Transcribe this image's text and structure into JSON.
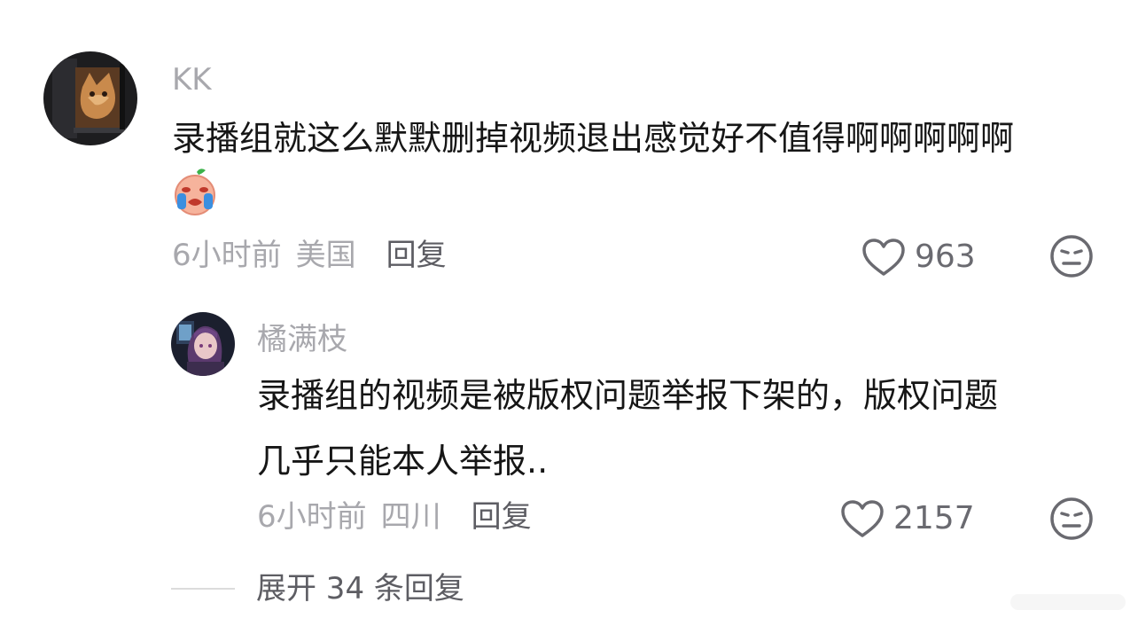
{
  "comments": [
    {
      "username": "KK",
      "text_line1": "录播组就这么默默删掉视频退出感觉好不值得啊啊啊啊啊",
      "emoji": "crying-face-emoji",
      "time": "6小时前",
      "location": "美国",
      "reply_label": "回复",
      "like_count": "963"
    },
    {
      "username": "橘满枝",
      "text_line1": "录播组的视频是被版权问题举报下架的，版权问题",
      "text_line2": "几乎只能本人举报..",
      "time": "6小时前",
      "location": "四川",
      "reply_label": "回复",
      "like_count": "2157"
    }
  ],
  "expand": {
    "label": "展开 34 条回复"
  },
  "colors": {
    "secondary_text": "#a8a8ad",
    "primary_text": "#161616",
    "action_text": "#5d5d63",
    "background": "#ffffff"
  },
  "icons": {
    "like": "heart-outline-icon",
    "dislike": "neutral-face-icon"
  }
}
